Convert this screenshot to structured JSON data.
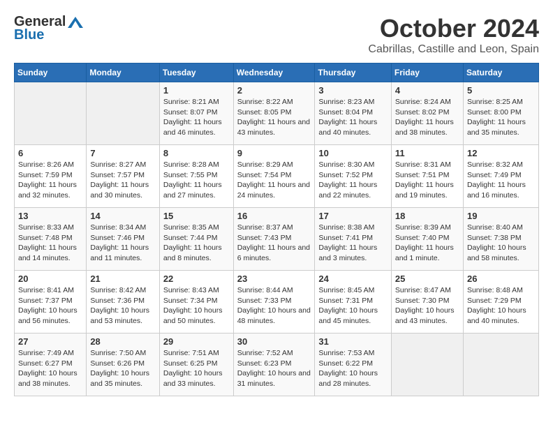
{
  "header": {
    "logo_general": "General",
    "logo_blue": "Blue",
    "title": "October 2024",
    "location": "Cabrillas, Castille and Leon, Spain"
  },
  "calendar": {
    "days_of_week": [
      "Sunday",
      "Monday",
      "Tuesday",
      "Wednesday",
      "Thursday",
      "Friday",
      "Saturday"
    ],
    "weeks": [
      [
        {
          "day": "",
          "info": ""
        },
        {
          "day": "",
          "info": ""
        },
        {
          "day": "1",
          "info": "Sunrise: 8:21 AM\nSunset: 8:07 PM\nDaylight: 11 hours and 46 minutes."
        },
        {
          "day": "2",
          "info": "Sunrise: 8:22 AM\nSunset: 8:05 PM\nDaylight: 11 hours and 43 minutes."
        },
        {
          "day": "3",
          "info": "Sunrise: 8:23 AM\nSunset: 8:04 PM\nDaylight: 11 hours and 40 minutes."
        },
        {
          "day": "4",
          "info": "Sunrise: 8:24 AM\nSunset: 8:02 PM\nDaylight: 11 hours and 38 minutes."
        },
        {
          "day": "5",
          "info": "Sunrise: 8:25 AM\nSunset: 8:00 PM\nDaylight: 11 hours and 35 minutes."
        }
      ],
      [
        {
          "day": "6",
          "info": "Sunrise: 8:26 AM\nSunset: 7:59 PM\nDaylight: 11 hours and 32 minutes."
        },
        {
          "day": "7",
          "info": "Sunrise: 8:27 AM\nSunset: 7:57 PM\nDaylight: 11 hours and 30 minutes."
        },
        {
          "day": "8",
          "info": "Sunrise: 8:28 AM\nSunset: 7:55 PM\nDaylight: 11 hours and 27 minutes."
        },
        {
          "day": "9",
          "info": "Sunrise: 8:29 AM\nSunset: 7:54 PM\nDaylight: 11 hours and 24 minutes."
        },
        {
          "day": "10",
          "info": "Sunrise: 8:30 AM\nSunset: 7:52 PM\nDaylight: 11 hours and 22 minutes."
        },
        {
          "day": "11",
          "info": "Sunrise: 8:31 AM\nSunset: 7:51 PM\nDaylight: 11 hours and 19 minutes."
        },
        {
          "day": "12",
          "info": "Sunrise: 8:32 AM\nSunset: 7:49 PM\nDaylight: 11 hours and 16 minutes."
        }
      ],
      [
        {
          "day": "13",
          "info": "Sunrise: 8:33 AM\nSunset: 7:48 PM\nDaylight: 11 hours and 14 minutes."
        },
        {
          "day": "14",
          "info": "Sunrise: 8:34 AM\nSunset: 7:46 PM\nDaylight: 11 hours and 11 minutes."
        },
        {
          "day": "15",
          "info": "Sunrise: 8:35 AM\nSunset: 7:44 PM\nDaylight: 11 hours and 8 minutes."
        },
        {
          "day": "16",
          "info": "Sunrise: 8:37 AM\nSunset: 7:43 PM\nDaylight: 11 hours and 6 minutes."
        },
        {
          "day": "17",
          "info": "Sunrise: 8:38 AM\nSunset: 7:41 PM\nDaylight: 11 hours and 3 minutes."
        },
        {
          "day": "18",
          "info": "Sunrise: 8:39 AM\nSunset: 7:40 PM\nDaylight: 11 hours and 1 minute."
        },
        {
          "day": "19",
          "info": "Sunrise: 8:40 AM\nSunset: 7:38 PM\nDaylight: 10 hours and 58 minutes."
        }
      ],
      [
        {
          "day": "20",
          "info": "Sunrise: 8:41 AM\nSunset: 7:37 PM\nDaylight: 10 hours and 56 minutes."
        },
        {
          "day": "21",
          "info": "Sunrise: 8:42 AM\nSunset: 7:36 PM\nDaylight: 10 hours and 53 minutes."
        },
        {
          "day": "22",
          "info": "Sunrise: 8:43 AM\nSunset: 7:34 PM\nDaylight: 10 hours and 50 minutes."
        },
        {
          "day": "23",
          "info": "Sunrise: 8:44 AM\nSunset: 7:33 PM\nDaylight: 10 hours and 48 minutes."
        },
        {
          "day": "24",
          "info": "Sunrise: 8:45 AM\nSunset: 7:31 PM\nDaylight: 10 hours and 45 minutes."
        },
        {
          "day": "25",
          "info": "Sunrise: 8:47 AM\nSunset: 7:30 PM\nDaylight: 10 hours and 43 minutes."
        },
        {
          "day": "26",
          "info": "Sunrise: 8:48 AM\nSunset: 7:29 PM\nDaylight: 10 hours and 40 minutes."
        }
      ],
      [
        {
          "day": "27",
          "info": "Sunrise: 7:49 AM\nSunset: 6:27 PM\nDaylight: 10 hours and 38 minutes."
        },
        {
          "day": "28",
          "info": "Sunrise: 7:50 AM\nSunset: 6:26 PM\nDaylight: 10 hours and 35 minutes."
        },
        {
          "day": "29",
          "info": "Sunrise: 7:51 AM\nSunset: 6:25 PM\nDaylight: 10 hours and 33 minutes."
        },
        {
          "day": "30",
          "info": "Sunrise: 7:52 AM\nSunset: 6:23 PM\nDaylight: 10 hours and 31 minutes."
        },
        {
          "day": "31",
          "info": "Sunrise: 7:53 AM\nSunset: 6:22 PM\nDaylight: 10 hours and 28 minutes."
        },
        {
          "day": "",
          "info": ""
        },
        {
          "day": "",
          "info": ""
        }
      ]
    ]
  }
}
